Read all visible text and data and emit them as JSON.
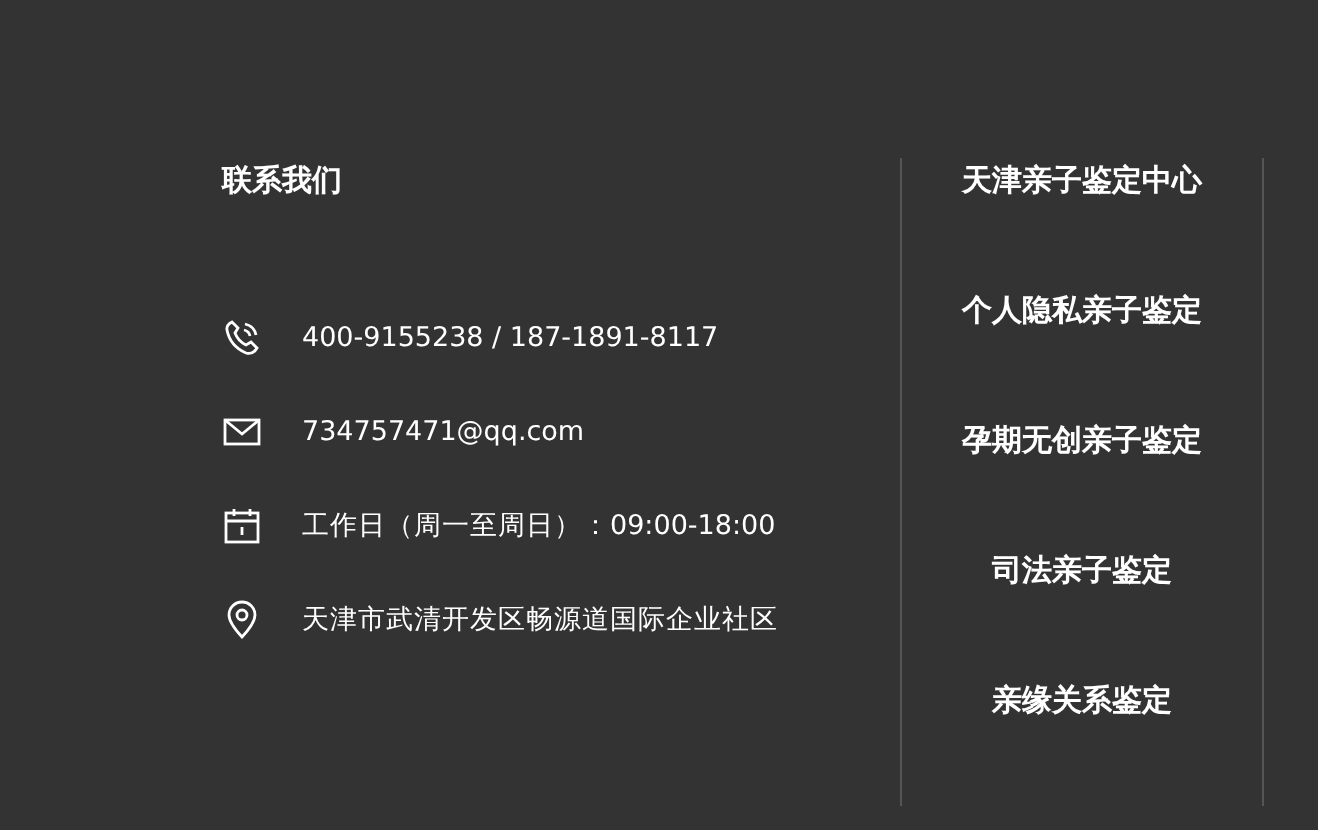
{
  "contact": {
    "title": "联系我们",
    "items": [
      {
        "kind": "phone",
        "text": "400-9155238 / 187-1891-8117"
      },
      {
        "kind": "email",
        "text": "734757471@qq.com"
      },
      {
        "kind": "hours",
        "text": "工作日（周一至周日）：09:00-18:00"
      },
      {
        "kind": "address",
        "text": "天津市武清开发区畅源道国际企业社区"
      }
    ]
  },
  "links": [
    "天津亲子鉴定中心",
    "个人隐私亲子鉴定",
    "孕期无创亲子鉴定",
    "司法亲子鉴定",
    "亲缘关系鉴定"
  ]
}
